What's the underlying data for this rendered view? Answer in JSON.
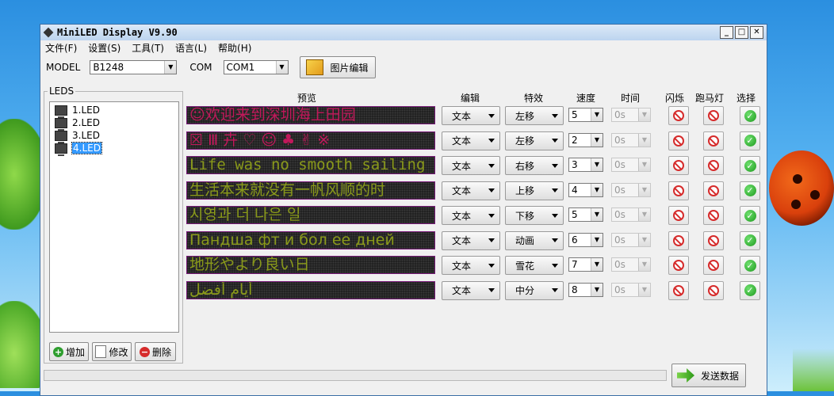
{
  "window": {
    "title": "MiniLED Display V9.90",
    "min": "_",
    "max": "□",
    "close": "✕"
  },
  "menu": [
    "文件(F)",
    "设置(S)",
    "工具(T)",
    "语言(L)",
    "帮助(H)"
  ],
  "toolbar": {
    "model_label": "MODEL",
    "model_value": "B1248",
    "com_label": "COM",
    "com_value": "COM1",
    "image_edit_label": "图片编辑"
  },
  "leds": {
    "group_label": "LEDS",
    "items": [
      "1.LED",
      "2.LED",
      "3.LED",
      "4.LED"
    ],
    "selected_index": 3,
    "add_label": "增加",
    "edit_label": "修改",
    "delete_label": "删除"
  },
  "columns": {
    "preview": "预览",
    "edit": "编辑",
    "effect": "特效",
    "speed": "速度",
    "time": "时间",
    "flash": "闪烁",
    "marquee": "跑马灯",
    "select": "选择"
  },
  "rows": [
    {
      "preview_text": "☺欢迎来到深圳海上田园",
      "color": "#c2185b",
      "edit": "文本",
      "effect": "左移",
      "speed": "5",
      "time": "0s"
    },
    {
      "preview_text": "☒ Ⅲ 卉 ♡ ☺ ♣ ✌ ※",
      "color": "#c2185b",
      "edit": "文本",
      "effect": "左移",
      "speed": "2",
      "time": "0s"
    },
    {
      "preview_text": "Life was no smooth sailing",
      "color": "#8a9a1a",
      "edit": "文本",
      "effect": "右移",
      "speed": "3",
      "time": "0s"
    },
    {
      "preview_text": "生活本来就没有一帆风顺的时",
      "color": "#8a9a1a",
      "edit": "文本",
      "effect": "上移",
      "speed": "4",
      "time": "0s"
    },
    {
      "preview_text": "시영과  더 나은  일",
      "color": "#8a9a1a",
      "edit": "文本",
      "effect": "下移",
      "speed": "5",
      "time": "0s"
    },
    {
      "preview_text": "Пандша  фт и бол ее дней",
      "color": "#8a9a1a",
      "edit": "文本",
      "effect": "动画",
      "speed": "6",
      "time": "0s"
    },
    {
      "preview_text": "地形やより良い日",
      "color": "#8a9a1a",
      "edit": "文本",
      "effect": "雪花",
      "speed": "7",
      "time": "0s"
    },
    {
      "preview_text": "أيام أفضل",
      "color": "#8a9a1a",
      "edit": "文本",
      "effect": "中分",
      "speed": "8",
      "time": "0s"
    }
  ],
  "send_label": "发送数据",
  "icons": {
    "flash": "no-entry-icon",
    "marquee": "no-entry-icon",
    "select": "check-circle-icon"
  }
}
